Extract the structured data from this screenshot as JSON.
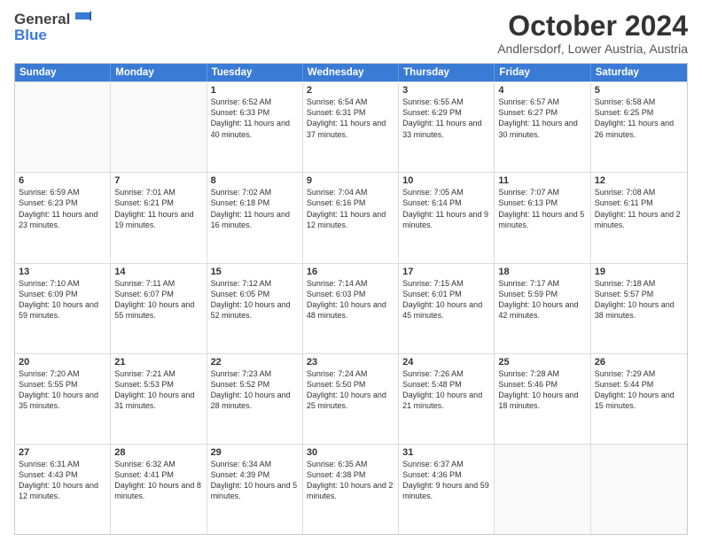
{
  "header": {
    "logo_general": "General",
    "logo_blue": "Blue",
    "title": "October 2024",
    "subtitle": "Andlersdorf, Lower Austria, Austria"
  },
  "days_of_week": [
    "Sunday",
    "Monday",
    "Tuesday",
    "Wednesday",
    "Thursday",
    "Friday",
    "Saturday"
  ],
  "weeks": [
    [
      {
        "day": "",
        "sunrise": "",
        "sunset": "",
        "daylight": "",
        "empty": true
      },
      {
        "day": "",
        "sunrise": "",
        "sunset": "",
        "daylight": "",
        "empty": true
      },
      {
        "day": "1",
        "sunrise": "Sunrise: 6:52 AM",
        "sunset": "Sunset: 6:33 PM",
        "daylight": "Daylight: 11 hours and 40 minutes.",
        "empty": false
      },
      {
        "day": "2",
        "sunrise": "Sunrise: 6:54 AM",
        "sunset": "Sunset: 6:31 PM",
        "daylight": "Daylight: 11 hours and 37 minutes.",
        "empty": false
      },
      {
        "day": "3",
        "sunrise": "Sunrise: 6:55 AM",
        "sunset": "Sunset: 6:29 PM",
        "daylight": "Daylight: 11 hours and 33 minutes.",
        "empty": false
      },
      {
        "day": "4",
        "sunrise": "Sunrise: 6:57 AM",
        "sunset": "Sunset: 6:27 PM",
        "daylight": "Daylight: 11 hours and 30 minutes.",
        "empty": false
      },
      {
        "day": "5",
        "sunrise": "Sunrise: 6:58 AM",
        "sunset": "Sunset: 6:25 PM",
        "daylight": "Daylight: 11 hours and 26 minutes.",
        "empty": false
      }
    ],
    [
      {
        "day": "6",
        "sunrise": "Sunrise: 6:59 AM",
        "sunset": "Sunset: 6:23 PM",
        "daylight": "Daylight: 11 hours and 23 minutes.",
        "empty": false
      },
      {
        "day": "7",
        "sunrise": "Sunrise: 7:01 AM",
        "sunset": "Sunset: 6:21 PM",
        "daylight": "Daylight: 11 hours and 19 minutes.",
        "empty": false
      },
      {
        "day": "8",
        "sunrise": "Sunrise: 7:02 AM",
        "sunset": "Sunset: 6:18 PM",
        "daylight": "Daylight: 11 hours and 16 minutes.",
        "empty": false
      },
      {
        "day": "9",
        "sunrise": "Sunrise: 7:04 AM",
        "sunset": "Sunset: 6:16 PM",
        "daylight": "Daylight: 11 hours and 12 minutes.",
        "empty": false
      },
      {
        "day": "10",
        "sunrise": "Sunrise: 7:05 AM",
        "sunset": "Sunset: 6:14 PM",
        "daylight": "Daylight: 11 hours and 9 minutes.",
        "empty": false
      },
      {
        "day": "11",
        "sunrise": "Sunrise: 7:07 AM",
        "sunset": "Sunset: 6:13 PM",
        "daylight": "Daylight: 11 hours and 5 minutes.",
        "empty": false
      },
      {
        "day": "12",
        "sunrise": "Sunrise: 7:08 AM",
        "sunset": "Sunset: 6:11 PM",
        "daylight": "Daylight: 11 hours and 2 minutes.",
        "empty": false
      }
    ],
    [
      {
        "day": "13",
        "sunrise": "Sunrise: 7:10 AM",
        "sunset": "Sunset: 6:09 PM",
        "daylight": "Daylight: 10 hours and 59 minutes.",
        "empty": false
      },
      {
        "day": "14",
        "sunrise": "Sunrise: 7:11 AM",
        "sunset": "Sunset: 6:07 PM",
        "daylight": "Daylight: 10 hours and 55 minutes.",
        "empty": false
      },
      {
        "day": "15",
        "sunrise": "Sunrise: 7:12 AM",
        "sunset": "Sunset: 6:05 PM",
        "daylight": "Daylight: 10 hours and 52 minutes.",
        "empty": false
      },
      {
        "day": "16",
        "sunrise": "Sunrise: 7:14 AM",
        "sunset": "Sunset: 6:03 PM",
        "daylight": "Daylight: 10 hours and 48 minutes.",
        "empty": false
      },
      {
        "day": "17",
        "sunrise": "Sunrise: 7:15 AM",
        "sunset": "Sunset: 6:01 PM",
        "daylight": "Daylight: 10 hours and 45 minutes.",
        "empty": false
      },
      {
        "day": "18",
        "sunrise": "Sunrise: 7:17 AM",
        "sunset": "Sunset: 5:59 PM",
        "daylight": "Daylight: 10 hours and 42 minutes.",
        "empty": false
      },
      {
        "day": "19",
        "sunrise": "Sunrise: 7:18 AM",
        "sunset": "Sunset: 5:57 PM",
        "daylight": "Daylight: 10 hours and 38 minutes.",
        "empty": false
      }
    ],
    [
      {
        "day": "20",
        "sunrise": "Sunrise: 7:20 AM",
        "sunset": "Sunset: 5:55 PM",
        "daylight": "Daylight: 10 hours and 35 minutes.",
        "empty": false
      },
      {
        "day": "21",
        "sunrise": "Sunrise: 7:21 AM",
        "sunset": "Sunset: 5:53 PM",
        "daylight": "Daylight: 10 hours and 31 minutes.",
        "empty": false
      },
      {
        "day": "22",
        "sunrise": "Sunrise: 7:23 AM",
        "sunset": "Sunset: 5:52 PM",
        "daylight": "Daylight: 10 hours and 28 minutes.",
        "empty": false
      },
      {
        "day": "23",
        "sunrise": "Sunrise: 7:24 AM",
        "sunset": "Sunset: 5:50 PM",
        "daylight": "Daylight: 10 hours and 25 minutes.",
        "empty": false
      },
      {
        "day": "24",
        "sunrise": "Sunrise: 7:26 AM",
        "sunset": "Sunset: 5:48 PM",
        "daylight": "Daylight: 10 hours and 21 minutes.",
        "empty": false
      },
      {
        "day": "25",
        "sunrise": "Sunrise: 7:28 AM",
        "sunset": "Sunset: 5:46 PM",
        "daylight": "Daylight: 10 hours and 18 minutes.",
        "empty": false
      },
      {
        "day": "26",
        "sunrise": "Sunrise: 7:29 AM",
        "sunset": "Sunset: 5:44 PM",
        "daylight": "Daylight: 10 hours and 15 minutes.",
        "empty": false
      }
    ],
    [
      {
        "day": "27",
        "sunrise": "Sunrise: 6:31 AM",
        "sunset": "Sunset: 4:43 PM",
        "daylight": "Daylight: 10 hours and 12 minutes.",
        "empty": false
      },
      {
        "day": "28",
        "sunrise": "Sunrise: 6:32 AM",
        "sunset": "Sunset: 4:41 PM",
        "daylight": "Daylight: 10 hours and 8 minutes.",
        "empty": false
      },
      {
        "day": "29",
        "sunrise": "Sunrise: 6:34 AM",
        "sunset": "Sunset: 4:39 PM",
        "daylight": "Daylight: 10 hours and 5 minutes.",
        "empty": false
      },
      {
        "day": "30",
        "sunrise": "Sunrise: 6:35 AM",
        "sunset": "Sunset: 4:38 PM",
        "daylight": "Daylight: 10 hours and 2 minutes.",
        "empty": false
      },
      {
        "day": "31",
        "sunrise": "Sunrise: 6:37 AM",
        "sunset": "Sunset: 4:36 PM",
        "daylight": "Daylight: 9 hours and 59 minutes.",
        "empty": false
      },
      {
        "day": "",
        "sunrise": "",
        "sunset": "",
        "daylight": "",
        "empty": true
      },
      {
        "day": "",
        "sunrise": "",
        "sunset": "",
        "daylight": "",
        "empty": true
      }
    ]
  ]
}
